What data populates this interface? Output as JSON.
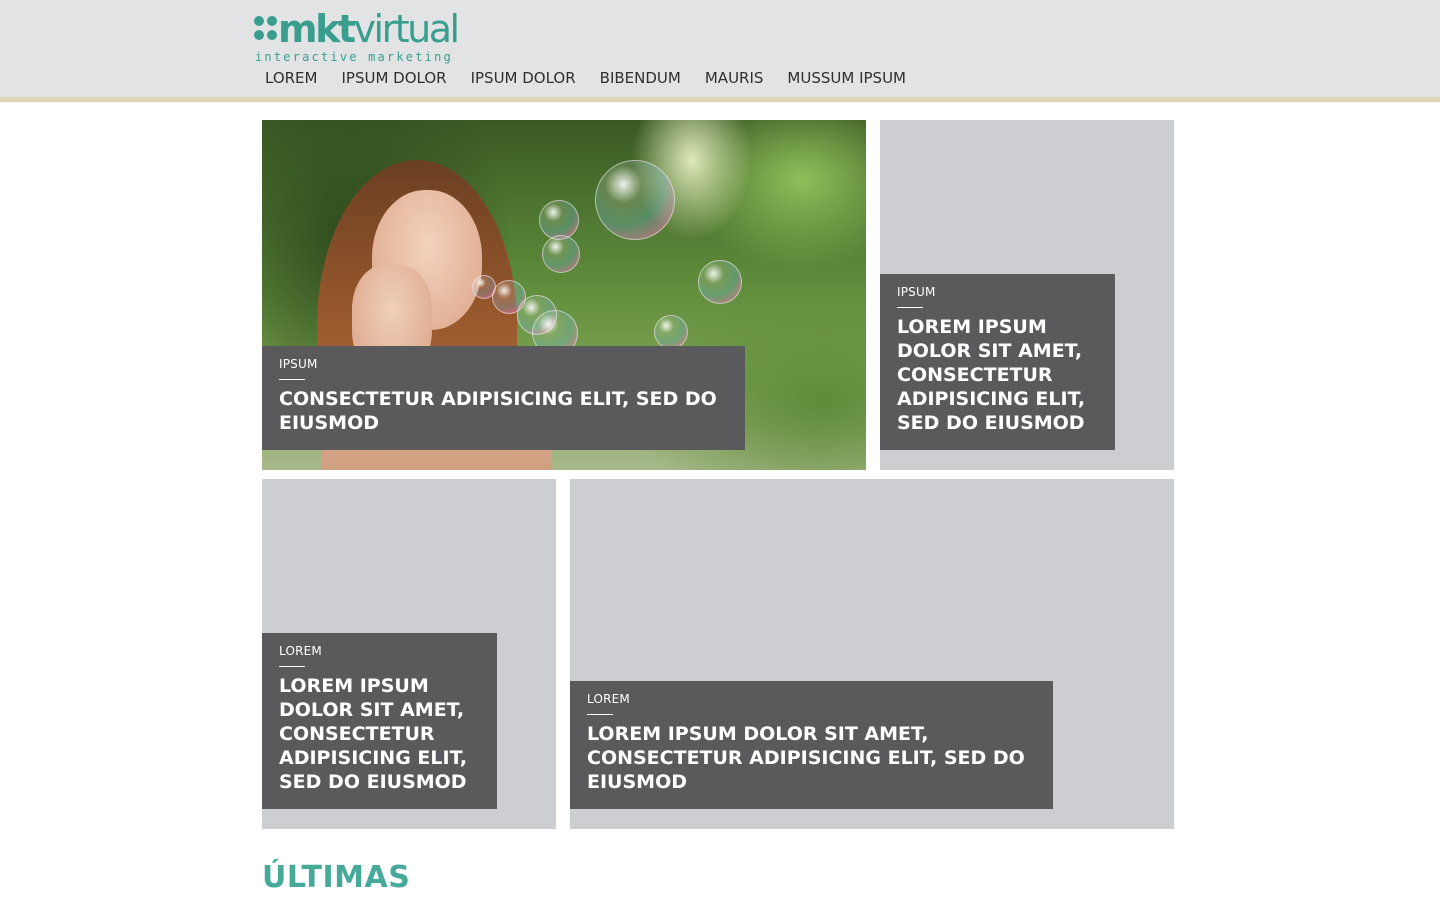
{
  "brand": {
    "name_part1": "mkt",
    "name_part2": "virtual",
    "tagline": "interactive marketing",
    "color": "#3a9e8f"
  },
  "nav": {
    "items": [
      "LOREM",
      "IPSUM DOLOR",
      "IPSUM DOLOR",
      "BIBENDUM",
      "MAURIS",
      "MUSSUM IPSUM"
    ]
  },
  "featured": [
    {
      "category": "IPSUM",
      "title": "CONSECTETUR ADIPISICING ELIT, SED DO EIUSMOD",
      "image": "girl-blowing-bubbles-photo"
    },
    {
      "category": "IPSUM",
      "title": "LOREM IPSUM DOLOR SIT AMET, CONSECTETUR ADIPISICING ELIT, SED DO EIUSMOD"
    },
    {
      "category": "LOREM",
      "title": "LOREM IPSUM DOLOR SIT AMET, CONSECTETUR ADIPISICING ELIT, SED DO EIUSMOD"
    },
    {
      "category": "LOREM",
      "title": "LOREM IPSUM DOLOR SIT AMET, CONSECTETUR ADIPISICING ELIT, SED DO EIUSMOD"
    }
  ],
  "latest": {
    "title": "ÚLTIMAS",
    "color": "#47a99a"
  },
  "colors": {
    "header_bg": "#e2e3e5",
    "header_border": "#ddd6b6",
    "tile_bg": "#cdced1",
    "caption_bg": "#5a5a5c"
  }
}
